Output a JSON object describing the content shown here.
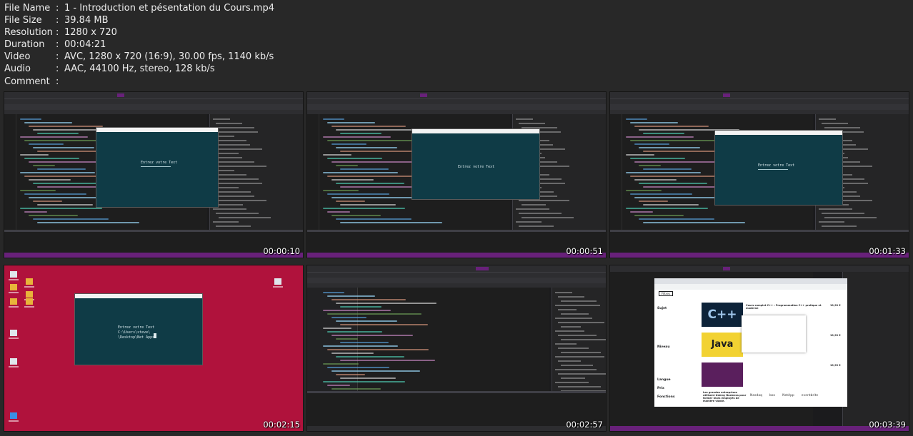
{
  "file_info": [
    {
      "key": "File Name",
      "value": "1 - Introduction et pésentation du Cours.mp4"
    },
    {
      "key": "File Size",
      "value": "39.84 MB"
    },
    {
      "key": "Resolution",
      "value": "1280 x 720"
    },
    {
      "key": "Duration",
      "value": "00:04:21"
    },
    {
      "key": "Video",
      "value": "AVC, 1280 x 720 (16:9), 30.00 fps, 1140 kb/s"
    },
    {
      "key": "Audio",
      "value": "AAC, 44100 Hz, stereo, 128 kb/s"
    },
    {
      "key": "Comment",
      "value": ""
    }
  ],
  "separator": ":",
  "thumbnails": [
    {
      "timestamp": "00:00:10",
      "scene": "ide"
    },
    {
      "timestamp": "00:00:51",
      "scene": "ide"
    },
    {
      "timestamp": "00:01:33",
      "scene": "ide"
    },
    {
      "timestamp": "00:02:15",
      "scene": "desktop"
    },
    {
      "timestamp": "00:02:57",
      "scene": "ide"
    },
    {
      "timestamp": "00:03:39",
      "scene": "browser"
    }
  ],
  "app_window_text": {
    "t1": "Entrez votre Text",
    "t2": "Entrez votre Text",
    "t4_line1": "Entrez votre Text",
    "t4_line2": "C:\\Users\\steve\\",
    "t4_line3": "\\Desktop\\Net Apps"
  },
  "browser_text": {
    "filters": "Filtres",
    "sujet": "Sujet",
    "niveau": "Niveau",
    "langue": "Langue",
    "prix": "Prix",
    "fonctions": "Fonctions",
    "course1_title": "Cours complet C++ : Programmation C++ pratique et moderne",
    "course2_title": "Java",
    "price": "19,99 €",
    "partners": [
      "Nasdaq",
      "box",
      "NetApp",
      "eventbrite"
    ],
    "promo": "Les grandes entreprises utilisent Udemy Business pour former leurs employés de manière viable."
  },
  "colors": {
    "background": "#282828",
    "text": "#ececec",
    "vs_purple": "#68217a",
    "desktop_red": "#b0123c",
    "app_teal": "#0f3b46"
  }
}
